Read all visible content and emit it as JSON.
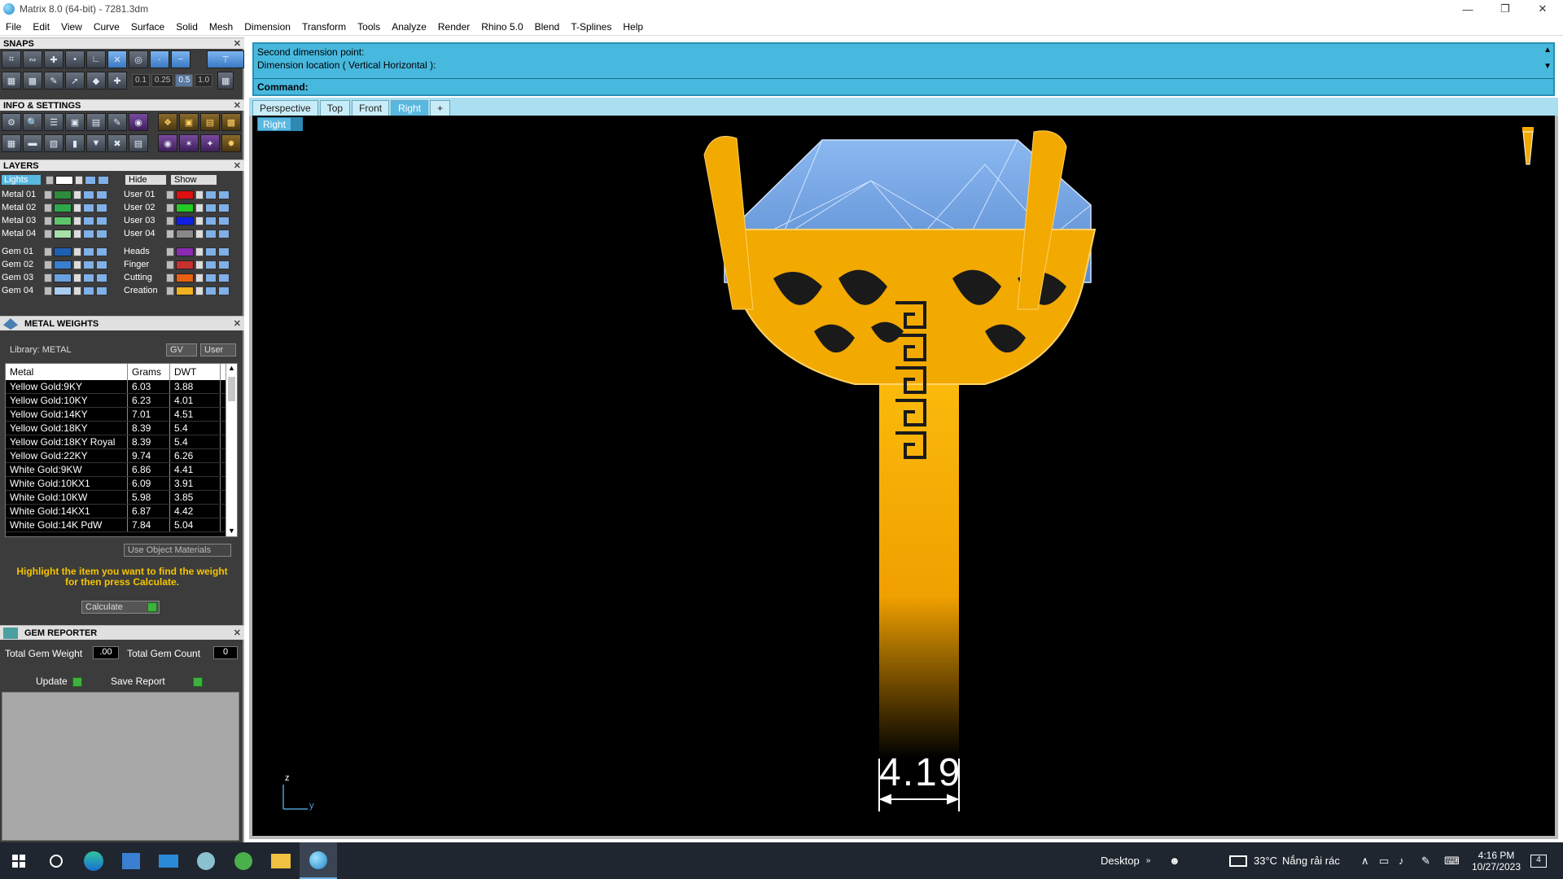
{
  "window": {
    "title": "Matrix 8.0 (64-bit) - 7281.3dm"
  },
  "menu": [
    "File",
    "Edit",
    "View",
    "Curve",
    "Surface",
    "Solid",
    "Mesh",
    "Dimension",
    "Transform",
    "Tools",
    "Analyze",
    "Render",
    "Rhino 5.0",
    "Blend",
    "T-Splines",
    "Help"
  ],
  "panels": {
    "snaps": {
      "title": "SNAPS",
      "values": [
        "0.1",
        "0.25",
        "0.5",
        "1.0"
      ]
    },
    "info": {
      "title": "INFO & SETTINGS"
    },
    "layers": {
      "title": "LAYERS",
      "lights": "Lights",
      "hide": "Hide",
      "show": "Show",
      "left": [
        {
          "name": "Metal 01",
          "color": "#2e8b3c"
        },
        {
          "name": "Metal 02",
          "color": "#2ea84a"
        },
        {
          "name": "Metal 03",
          "color": "#5ec46c"
        },
        {
          "name": "Metal 04",
          "color": "#a4e0a8"
        },
        {
          "name": "Gem 01",
          "color": "#1f5fb4"
        },
        {
          "name": "Gem 02",
          "color": "#3a7ed0"
        },
        {
          "name": "Gem 03",
          "color": "#6aa2e0"
        },
        {
          "name": "Gem 04",
          "color": "#a8cbf0"
        }
      ],
      "right": [
        {
          "name": "User 01",
          "color": "#e01010"
        },
        {
          "name": "User 02",
          "color": "#22cc22"
        },
        {
          "name": "User 03",
          "color": "#1020e0"
        },
        {
          "name": "User 04",
          "color": "#888888"
        },
        {
          "name": "Heads",
          "color": "#8a2ab0"
        },
        {
          "name": "Finger",
          "color": "#c83030"
        },
        {
          "name": "Cutting",
          "color": "#e86010"
        },
        {
          "name": "Creation",
          "color": "#f0b020"
        }
      ]
    },
    "metal_weights": {
      "title": "METAL WEIGHTS",
      "library": "Library: METAL",
      "gv": "GV",
      "user": "User",
      "headers": [
        "Metal",
        "Grams",
        "DWT"
      ],
      "rows": [
        [
          "Yellow Gold:9KY",
          "6.03",
          "3.88"
        ],
        [
          "Yellow Gold:10KY",
          "6.23",
          "4.01"
        ],
        [
          "Yellow Gold:14KY",
          "7.01",
          "4.51"
        ],
        [
          "Yellow Gold:18KY",
          "8.39",
          "5.4"
        ],
        [
          "Yellow Gold:18KY Royal",
          "8.39",
          "5.4"
        ],
        [
          "Yellow Gold:22KY",
          "9.74",
          "6.26"
        ],
        [
          "White Gold:9KW",
          "6.86",
          "4.41"
        ],
        [
          "White Gold:10KX1",
          "6.09",
          "3.91"
        ],
        [
          "White Gold:10KW",
          "5.98",
          "3.85"
        ],
        [
          "White Gold:14KX1",
          "6.87",
          "4.42"
        ],
        [
          "White Gold:14K PdW",
          "7.84",
          "5.04"
        ]
      ],
      "use_object_materials": "Use Object Materials",
      "hint": "Highlight the item you want to find the weight for then press Calculate.",
      "calculate": "Calculate"
    },
    "gem_reporter": {
      "title": "GEM REPORTER",
      "total_weight_label": "Total Gem Weight",
      "total_weight": ".00",
      "total_count_label": "Total Gem Count",
      "total_count": "0",
      "update": "Update",
      "save_report": "Save Report"
    }
  },
  "command": {
    "line1": "Second dimension point:",
    "line2": "Dimension location ( Vertical  Horizontal ):",
    "prompt": "Command:"
  },
  "viewport": {
    "tabs": [
      "Perspective",
      "Top",
      "Front",
      "Right",
      "+"
    ],
    "active_tab": "Right",
    "name": "Right",
    "dimension": "4.19",
    "axis_z": "z",
    "axis_y": "y"
  },
  "taskbar": {
    "desktop": "Desktop",
    "weather_temp": "33°C",
    "weather_text": "Nắng rải rác",
    "time": "4:16 PM",
    "date": "10/27/2023",
    "notifications": "4"
  },
  "colors": {
    "accent": "#47b8de",
    "gold": "#f0a800",
    "panel": "#3c3c3c"
  }
}
